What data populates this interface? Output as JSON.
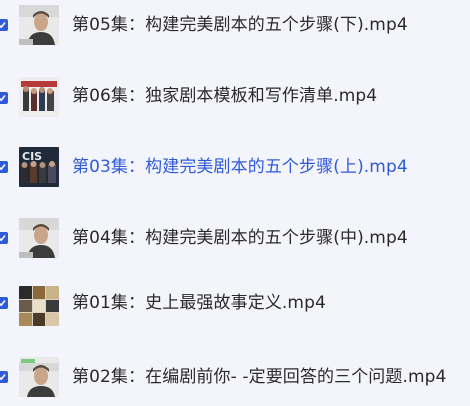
{
  "playlist": {
    "items": [
      {
        "title": "第05集：构建完美剧本的五个步骤(下).mp4",
        "checked": true,
        "active": false,
        "thumb": "portrait-thumbnail"
      },
      {
        "title": "第06集：独家剧本模板和写作清单.mp4",
        "checked": true,
        "active": false,
        "thumb": "group-photo-thumbnail"
      },
      {
        "title": "第03集：构建完美剧本的五个步骤(上).mp4",
        "checked": true,
        "active": true,
        "thumb": "tv-show-thumbnail"
      },
      {
        "title": "第04集：构建完美剧本的五个步骤(中).mp4",
        "checked": true,
        "active": false,
        "thumb": "portrait-thumbnail"
      },
      {
        "title": "第01集：史上最强故事定义.mp4",
        "checked": true,
        "active": false,
        "thumb": "poster-collage-thumbnail"
      },
      {
        "title": "第02集：在编剧前你- -定要回答的三个问题.mp4",
        "checked": true,
        "active": false,
        "thumb": "portrait-thumbnail"
      }
    ]
  },
  "colors": {
    "background": "#f4f4fd",
    "accent": "#2f5bd8",
    "text": "#2a2a2a"
  }
}
